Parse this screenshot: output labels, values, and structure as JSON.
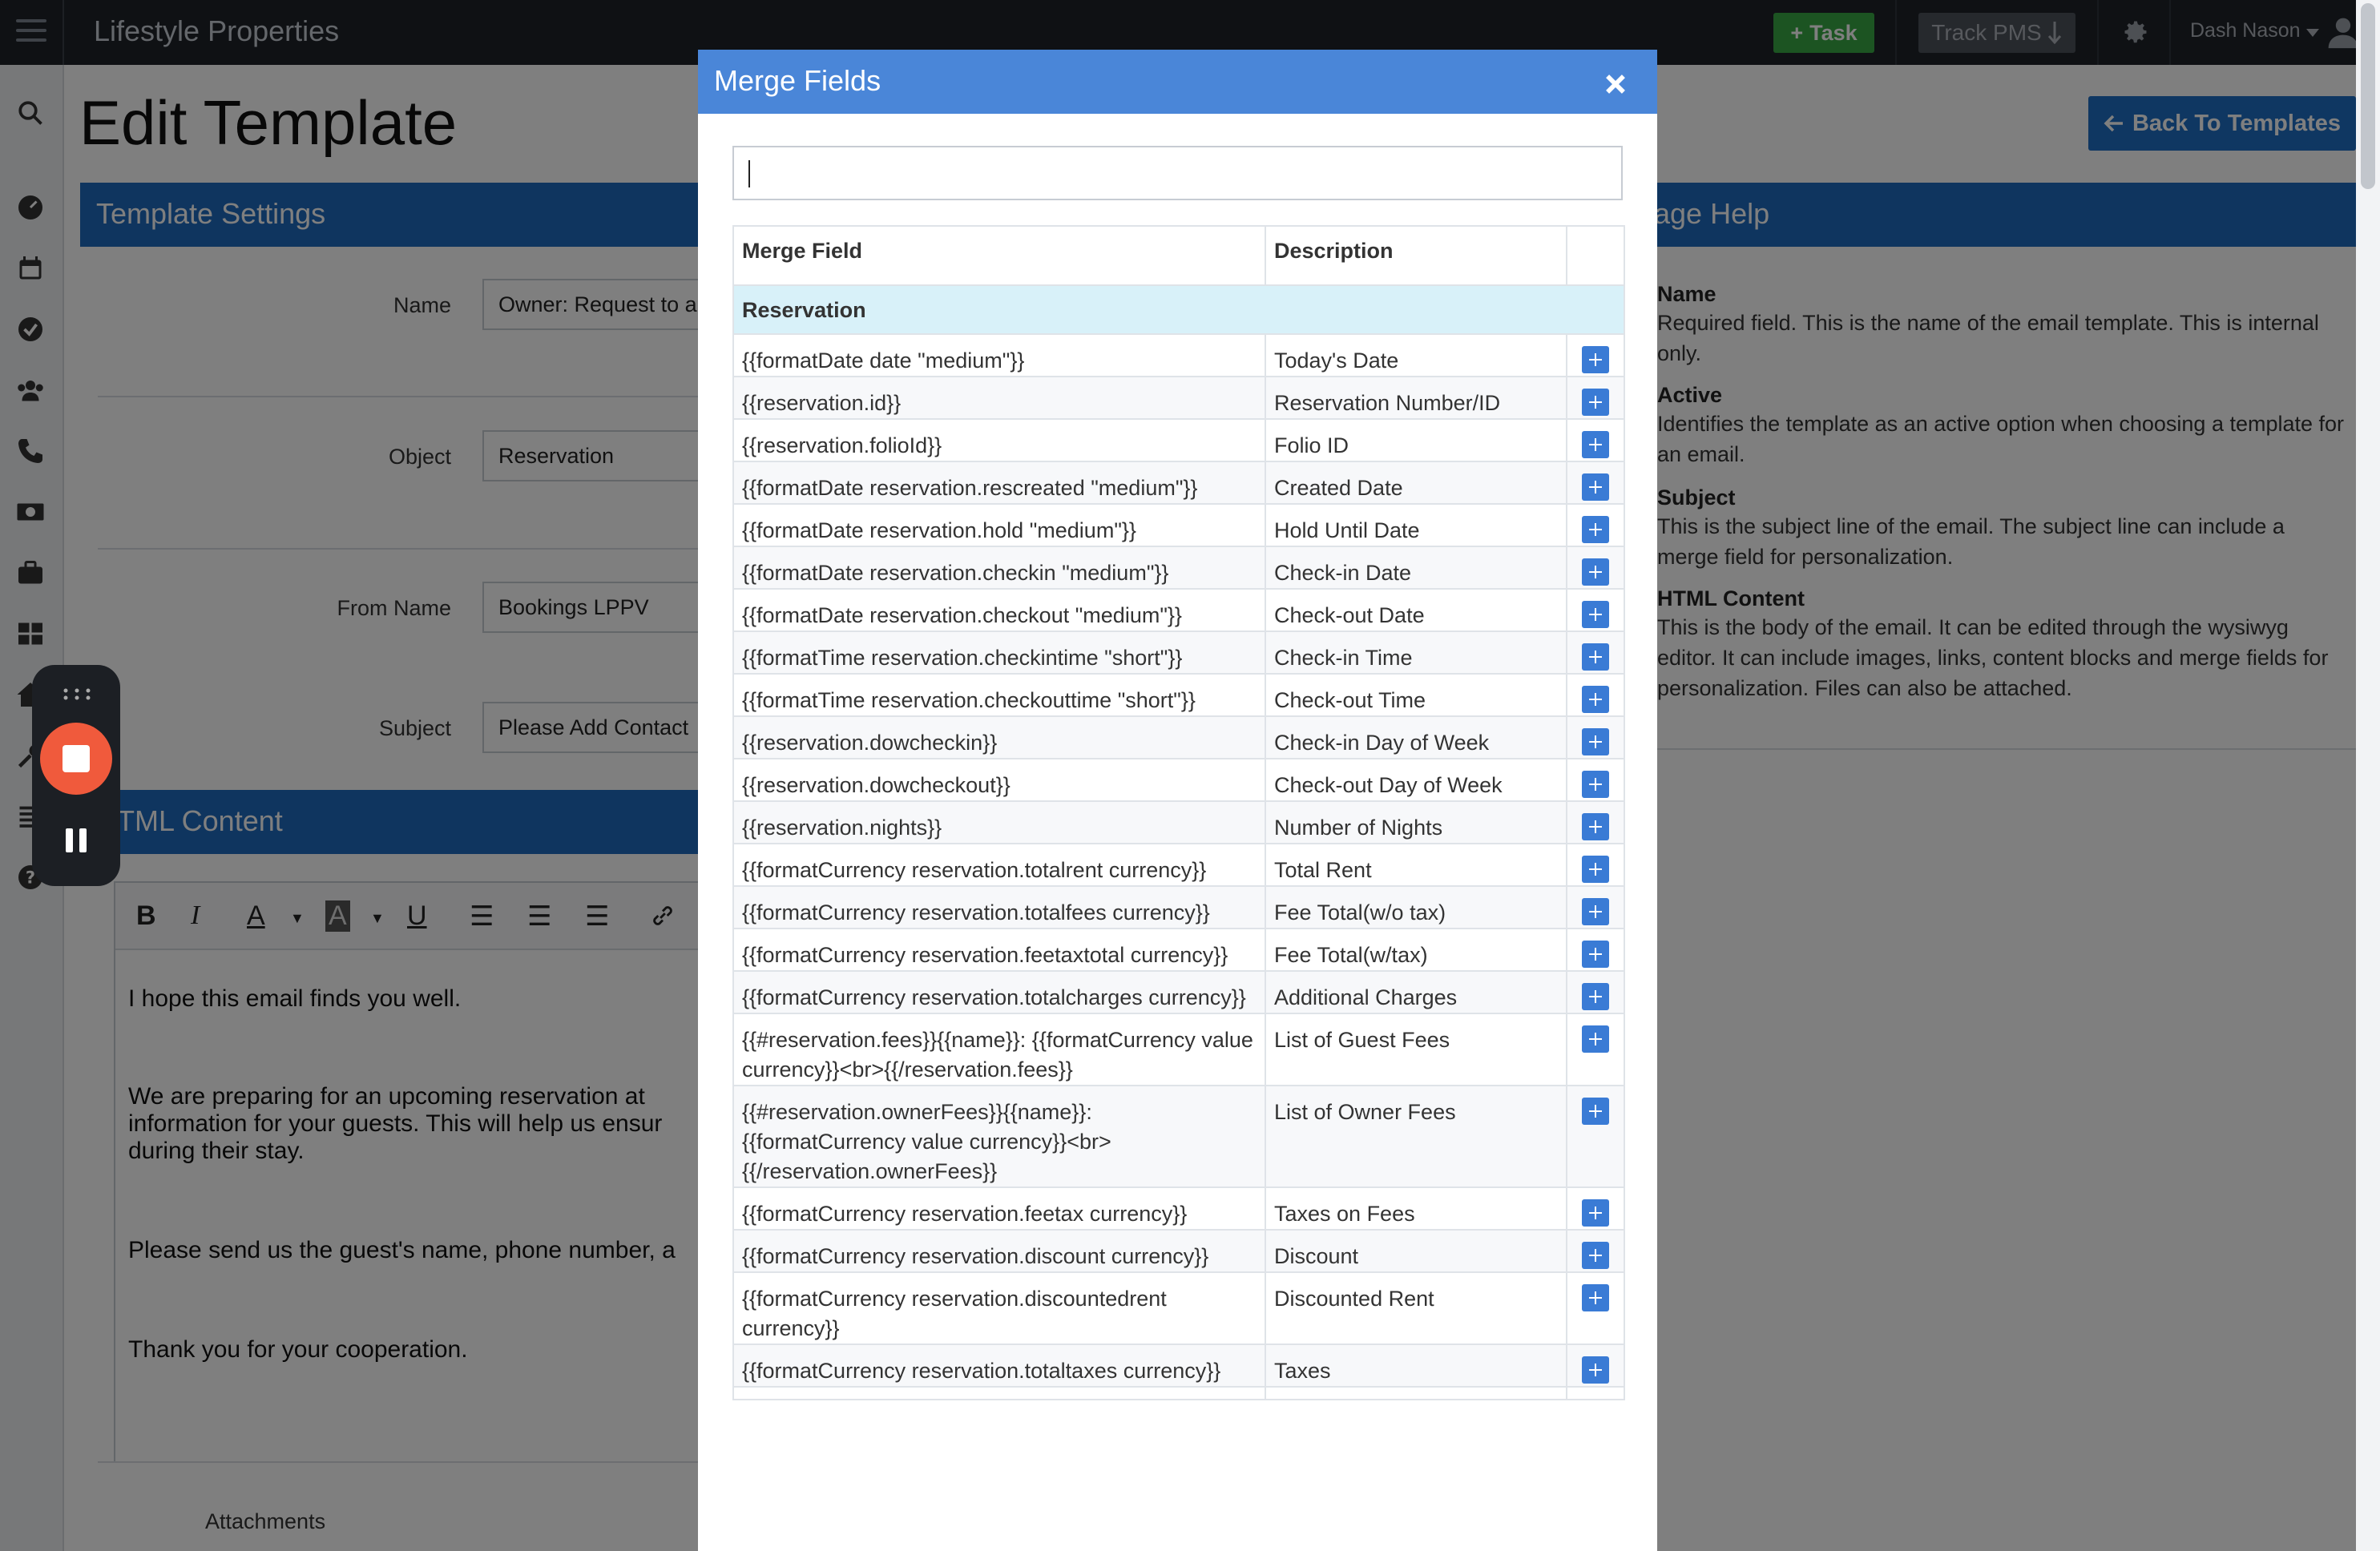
{
  "topbar": {
    "app_title": "Lifestyle Properties",
    "task_label": "Task",
    "track_label": "Track PMS",
    "user_name": "Dash Nason"
  },
  "page": {
    "title": "Edit Template",
    "back_button": "Back To Templates",
    "settings_title": "Template Settings",
    "help_title": "age Help",
    "form": {
      "name_label": "Name",
      "name_value": "Owner: Request to a",
      "object_label": "Object",
      "object_value": "Reservation",
      "from_label": "From Name",
      "from_value": "Bookings LPPV",
      "subject_label": "Subject",
      "subject_value": "Please Add Contact"
    },
    "html_content_title": "TML Content",
    "editor": {
      "line1": "I hope this email finds you well.",
      "line2": "We are preparing for an upcoming reservation at",
      "line3": "information for your guests. This will help us ensur",
      "line4": "during their stay.",
      "line5": "Please send us the guest's name, phone number, a",
      "line6": "Thank you for your cooperation."
    },
    "attachments_label": "Attachments",
    "help": [
      {
        "title": "Name",
        "text": "Required field. This is the name of the email template. This is internal only."
      },
      {
        "title": "Active",
        "text": "Identifies the template as an active option when choosing a template for an email."
      },
      {
        "title": "Subject",
        "text": "This is the subject line of the email. The subject line can include a merge field for personalization."
      },
      {
        "title": "HTML Content",
        "text": "This is the body of the email. It can be edited through the wysiwyg editor. It can include images, links, content blocks and merge fields for personalization. Files can also be attached."
      }
    ]
  },
  "modal": {
    "title": "Merge Fields",
    "search_value": "",
    "columns": [
      "Merge Field",
      "Description",
      ""
    ],
    "group": "Reservation",
    "rows": [
      {
        "field": "{{formatDate date \"medium\"}}",
        "desc": "Today's Date"
      },
      {
        "field": "{{reservation.id}}",
        "desc": "Reservation Number/ID"
      },
      {
        "field": "{{reservation.folioId}}",
        "desc": "Folio ID"
      },
      {
        "field": "{{formatDate reservation.rescreated \"medium\"}}",
        "desc": "Created Date"
      },
      {
        "field": "{{formatDate reservation.hold \"medium\"}}",
        "desc": "Hold Until Date"
      },
      {
        "field": "{{formatDate reservation.checkin \"medium\"}}",
        "desc": "Check-in Date"
      },
      {
        "field": "{{formatDate reservation.checkout \"medium\"}}",
        "desc": "Check-out Date"
      },
      {
        "field": "{{formatTime reservation.checkintime \"short\"}}",
        "desc": "Check-in Time"
      },
      {
        "field": "{{formatTime reservation.checkouttime \"short\"}}",
        "desc": "Check-out Time"
      },
      {
        "field": "{{reservation.dowcheckin}}",
        "desc": "Check-in Day of Week"
      },
      {
        "field": "{{reservation.dowcheckout}}",
        "desc": "Check-out Day of Week"
      },
      {
        "field": "{{reservation.nights}}",
        "desc": "Number of Nights"
      },
      {
        "field": "{{formatCurrency reservation.totalrent currency}}",
        "desc": "Total Rent"
      },
      {
        "field": "{{formatCurrency reservation.totalfees currency}}",
        "desc": "Fee Total(w/o tax)"
      },
      {
        "field": "{{formatCurrency reservation.feetaxtotal currency}}",
        "desc": "Fee Total(w/tax)"
      },
      {
        "field": "{{formatCurrency reservation.totalcharges currency}}",
        "desc": "Additional Charges"
      },
      {
        "field": "{{#reservation.fees}}{{name}}: {{formatCurrency value currency}}<br>{{/reservation.fees}}",
        "desc": "List of Guest Fees"
      },
      {
        "field": "{{#reservation.ownerFees}}{{name}}: {{formatCurrency value currency}}<br> {{/reservation.ownerFees}}",
        "desc": "List of Owner Fees"
      },
      {
        "field": "{{formatCurrency reservation.feetax currency}}",
        "desc": "Taxes on Fees"
      },
      {
        "field": "{{formatCurrency reservation.discount currency}}",
        "desc": "Discount"
      },
      {
        "field": "{{formatCurrency reservation.discountedrent currency}}",
        "desc": "Discounted Rent"
      },
      {
        "field": "{{formatCurrency reservation.totaltaxes currency}}",
        "desc": "Taxes"
      },
      {
        "field": "",
        "desc": ""
      }
    ]
  }
}
